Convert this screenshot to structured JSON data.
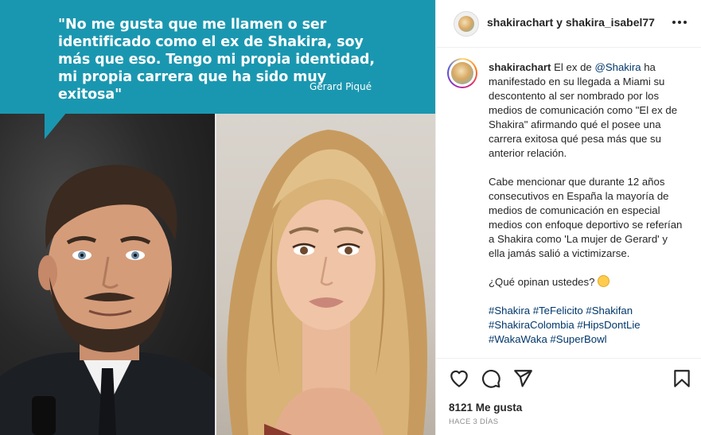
{
  "quote": {
    "text": "\"No me gusta que me llamen o ser identificado como el ex de Shakira,  soy más que eso. Tengo mi  propia identidad,  mi  propia carrera que ha sido muy exitosa\"",
    "author": "Gerard Piqué"
  },
  "header": {
    "user1": "shakirachart",
    "connector": "y",
    "user2": "shakira_isabel77",
    "more_icon": "more-horizontal-icon"
  },
  "caption": {
    "username": "shakirachart",
    "text_before_mention": "El ex de",
    "mention": "@Shakira",
    "text_after_mention": "ha manifestado en su llegada a Miami su descontento al ser nombrado por los medios de comunicación como \"El ex de Shakira\" afirmando qué el posee una carrera exitosa qué pesa más que su anterior relación.",
    "paragraph2": "Cabe mencionar que durante 12 años consecutivos en España la mayoría de medios de comunicación en especial medios con enfoque deportivo se referían a Shakira como 'La mujer de Gerard' y ella jamás salió a victimizarse.",
    "question": "¿Qué opinan ustedes?",
    "hashtags_line1": "#Shakira #TeFelicito #Shakifan",
    "hashtags_line2": "#ShakiraColombia #HipsDontLie",
    "hashtags_line3": "#WakaWaka #SuperBowl"
  },
  "actions": {
    "like_icon": "heart-icon",
    "comment_icon": "comment-icon",
    "share_icon": "send-icon",
    "save_icon": "bookmark-icon"
  },
  "likes": "8121 Me gusta",
  "timestamp": "HACE 3 DÍAS"
}
